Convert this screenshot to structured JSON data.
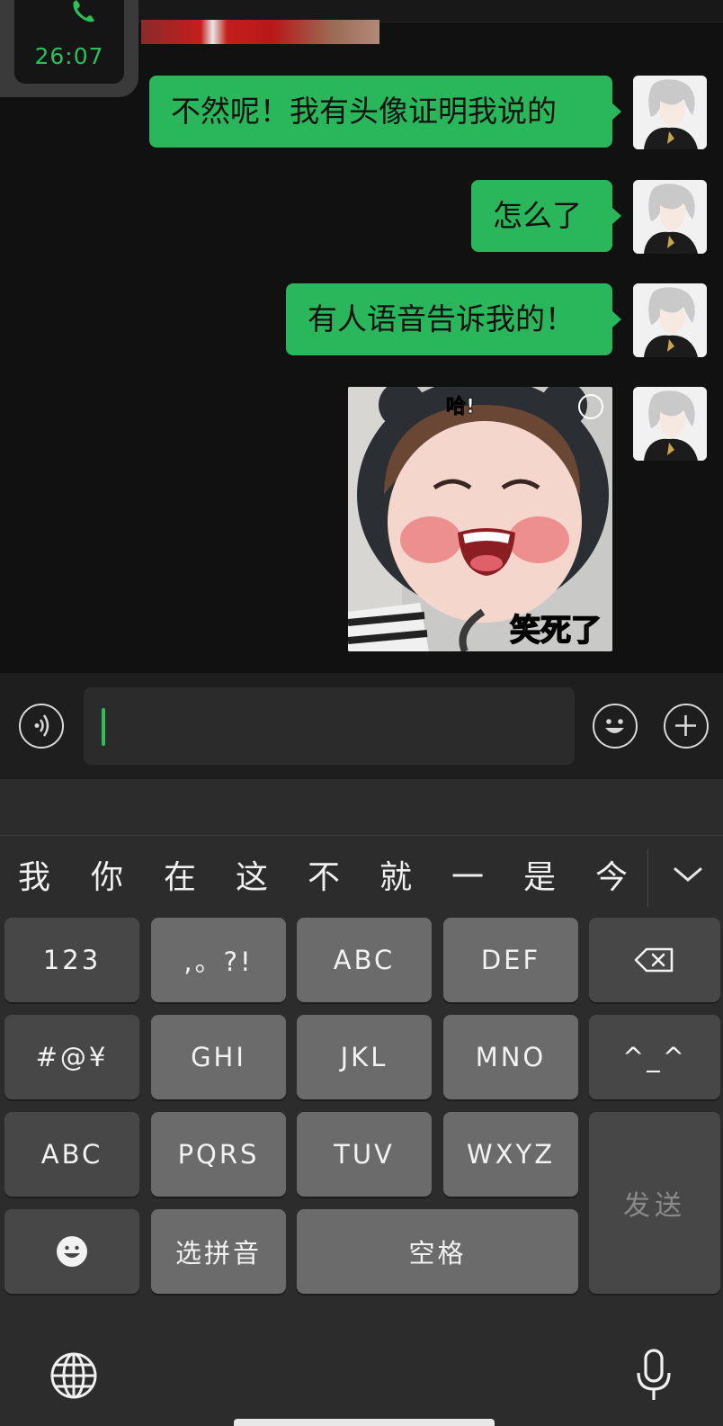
{
  "call": {
    "time": "26:07",
    "icon": "phone-icon"
  },
  "messages": [
    {
      "text": "不然呢！我有头像证明我说的"
    },
    {
      "text": "怎么了"
    },
    {
      "text": "有人语音告诉我的！"
    }
  ],
  "sticker": {
    "top_text": "哈!",
    "caption": "笑死了"
  },
  "input": {
    "value": ""
  },
  "keyboard": {
    "candidates": [
      "我",
      "你",
      "在",
      "这",
      "不",
      "就",
      "一",
      "是",
      "今天"
    ],
    "keys": {
      "k123": "123",
      "punct": ",。?!",
      "abc": "ABC",
      "def": "DEF",
      "symbols": "#@¥",
      "ghi": "GHI",
      "jkl": "JKL",
      "mno": "MNO",
      "kaomoji": "^_^",
      "abc_mode": "ABC",
      "pqrs": "PQRS",
      "tuv": "TUV",
      "wxyz": "WXYZ",
      "send": "发送",
      "pinyin": "选拼音",
      "space": "空格"
    }
  },
  "colors": {
    "accent": "#2ab65a",
    "call_green": "#2fbf5a"
  }
}
